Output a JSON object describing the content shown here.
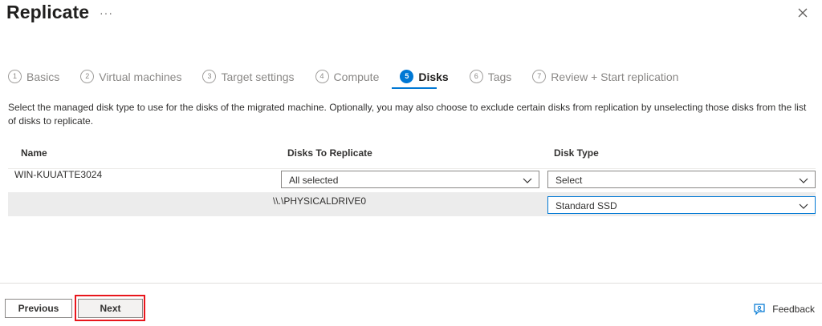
{
  "header": {
    "title": "Replicate",
    "more": "···"
  },
  "steps": [
    {
      "num": "1",
      "label": "Basics"
    },
    {
      "num": "2",
      "label": "Virtual machines"
    },
    {
      "num": "3",
      "label": "Target settings"
    },
    {
      "num": "4",
      "label": "Compute"
    },
    {
      "num": "5",
      "label": "Disks",
      "active": true
    },
    {
      "num": "6",
      "label": "Tags"
    },
    {
      "num": "7",
      "label": "Review + Start replication"
    }
  ],
  "description": "Select the managed disk type to use for the disks of the migrated machine. Optionally, you may also choose to exclude certain disks from replication by unselecting those disks from the list of disks to replicate.",
  "table": {
    "columns": [
      "Name",
      "Disks To Replicate",
      "Disk Type"
    ],
    "rows": [
      {
        "name": "WIN-KUUATTE3024",
        "disks": "All selected",
        "disk_type": "Select"
      },
      {
        "name": "",
        "disks": "\\\\.\\PHYSICALDRIVE0",
        "disk_type": "Standard SSD"
      }
    ]
  },
  "footer": {
    "previous": "Previous",
    "next": "Next",
    "feedback": "Feedback"
  },
  "colors": {
    "accent": "#0078d4",
    "highlight": "#e8161c"
  }
}
